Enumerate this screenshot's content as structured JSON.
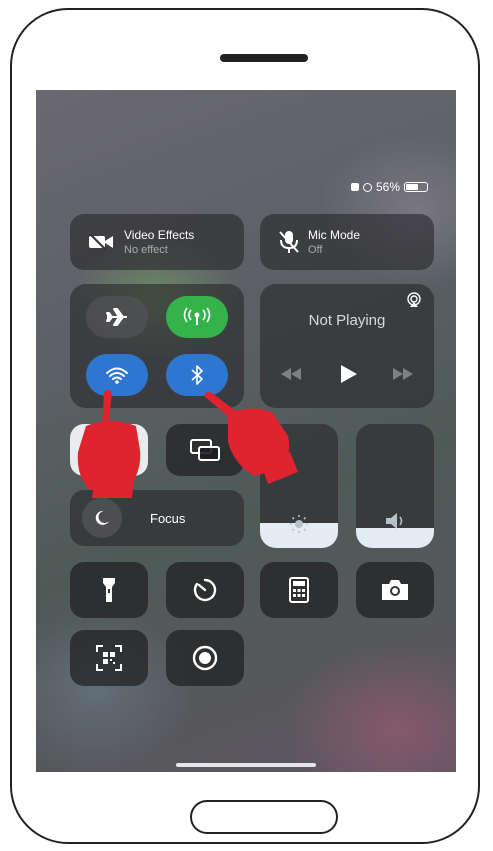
{
  "status_bar": {
    "battery_percent": "56%",
    "battery_level": 0.56
  },
  "video_effects": {
    "title": "Video Effects",
    "subtitle": "No effect",
    "icon": "video-camera-icon"
  },
  "mic_mode": {
    "title": "Mic Mode",
    "subtitle": "Off",
    "icon": "microphone-icon"
  },
  "connectivity": {
    "airplane": {
      "icon": "airplane-icon",
      "active": false
    },
    "cellular": {
      "icon": "cellular-antenna-icon",
      "active": true,
      "color": "#33b34a"
    },
    "wifi": {
      "icon": "wifi-icon",
      "active": true,
      "color": "#2e77d0"
    },
    "bluetooth": {
      "icon": "bluetooth-icon",
      "active": true,
      "color": "#2e77d0"
    }
  },
  "now_playing": {
    "status": "Not Playing",
    "icons": [
      "airplay-icon",
      "rewind-icon",
      "play-icon",
      "fast-forward-icon"
    ]
  },
  "focus": {
    "label": "Focus",
    "icon": "moon-icon"
  },
  "sliders": {
    "brightness": {
      "icon": "sun-icon",
      "level": 0.2
    },
    "volume": {
      "icon": "speaker-icon",
      "level": 0.16
    }
  },
  "controls": [
    "flashlight-icon",
    "timer-icon",
    "calculator-icon",
    "camera-icon",
    "qr-scanner-icon",
    "screen-record-icon"
  ],
  "annotations": {
    "color": "#e0242f"
  }
}
